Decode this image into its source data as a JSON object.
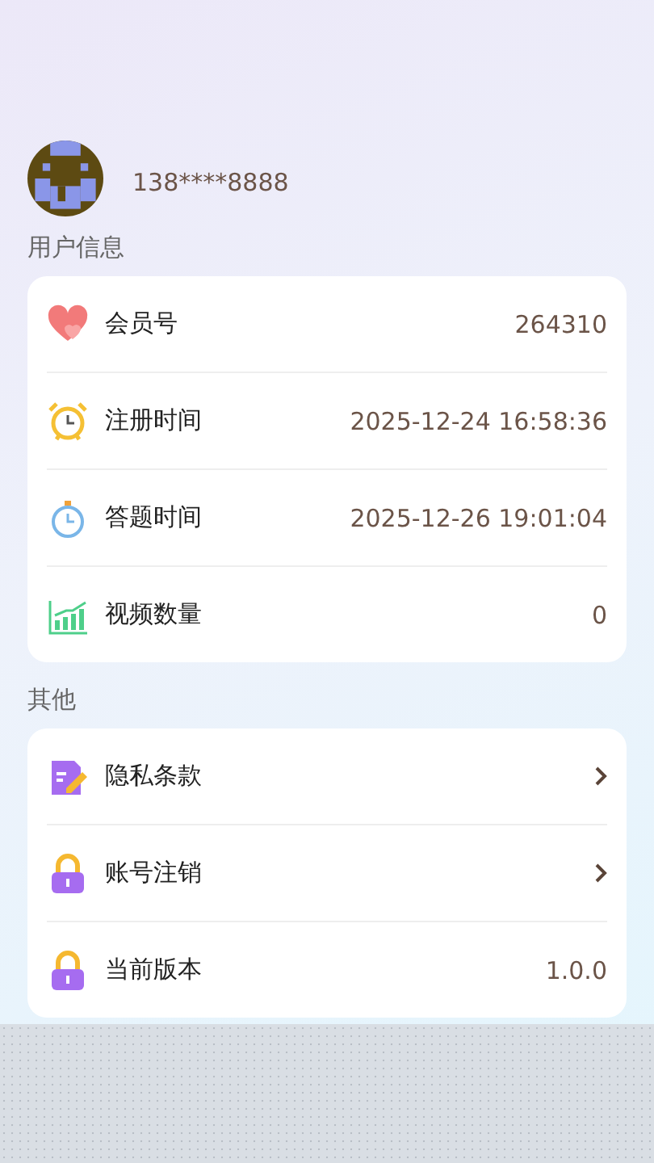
{
  "profile": {
    "phone": "138****8888"
  },
  "sections": [
    {
      "title": "用户信息",
      "rows": [
        {
          "kind": "value",
          "label": "会员号",
          "value": "264310"
        },
        {
          "kind": "value",
          "label": "注册时间",
          "value": "2025-12-24 16:58:36"
        },
        {
          "kind": "value",
          "label": "答题时间",
          "value": "2025-12-26 19:01:04"
        },
        {
          "kind": "value",
          "label": "视频数量",
          "value": "0"
        }
      ]
    },
    {
      "title": "其他",
      "rows": [
        {
          "kind": "link",
          "label": "隐私条款"
        },
        {
          "kind": "link",
          "label": "账号注销"
        },
        {
          "kind": "value",
          "label": "当前版本",
          "value": "1.0.0"
        }
      ]
    }
  ]
}
